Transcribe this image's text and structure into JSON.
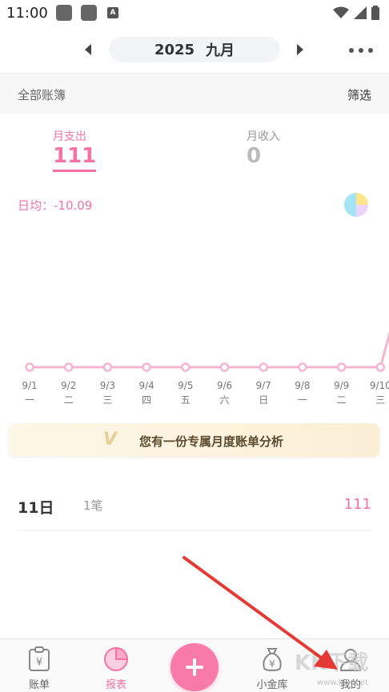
{
  "status_bar": {
    "time": "11:00",
    "notif_icon": "A"
  },
  "header": {
    "year": "2025",
    "month": "九月"
  },
  "filter_bar": {
    "book": "全部账簿",
    "filter": "筛选"
  },
  "totals": {
    "expense_label": "月支出",
    "expense_value": "111",
    "income_label": "月收入",
    "income_value": "0"
  },
  "daily_avg": "日均：-10.09",
  "colors": {
    "accent": "#f472a4",
    "line": "#f4b6cc",
    "banner": "#fbf0d6"
  },
  "chart_data": {
    "type": "line",
    "x": [
      "9/1",
      "9/2",
      "9/3",
      "9/4",
      "9/5",
      "9/6",
      "9/7",
      "9/8",
      "9/9",
      "9/10"
    ],
    "weekdays": [
      "一",
      "二",
      "三",
      "四",
      "五",
      "六",
      "日",
      "一",
      "二",
      "三"
    ],
    "values": [
      0,
      0,
      0,
      0,
      0,
      0,
      0,
      0,
      0,
      0
    ],
    "note_offscreen": "line rises sharply after 9/10 (9/11 = 111)"
  },
  "banner": {
    "v": "V",
    "text": "您有一份专属月度账单分析"
  },
  "day_entry": {
    "day": "11日",
    "count": "1笔",
    "amount": "111"
  },
  "nav": {
    "bill": "账单",
    "report": "报表",
    "vault": "小金库",
    "mine": "我的"
  },
  "watermark": {
    "text": "KK下载",
    "url": "www.kkx.net"
  }
}
